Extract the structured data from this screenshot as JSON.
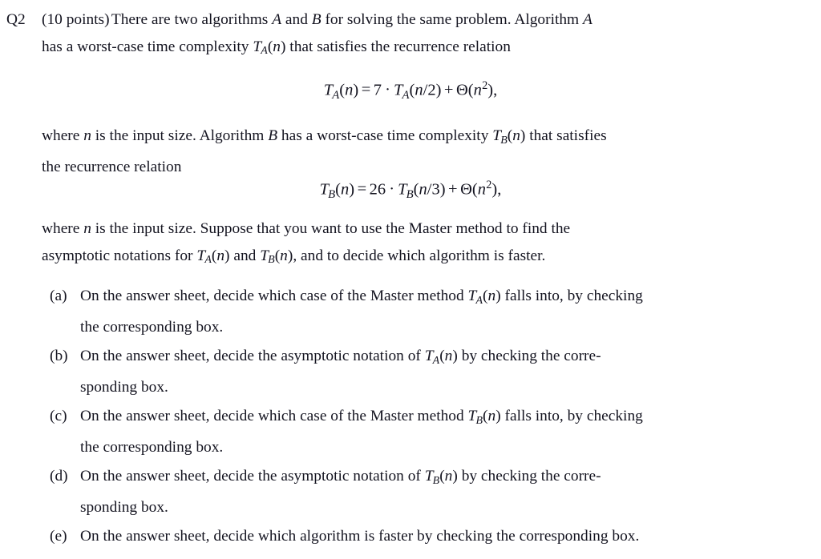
{
  "document": {
    "type": "exam-question",
    "background_color": "#ffffff",
    "text_color": "#141420"
  },
  "question": {
    "label": "Q2",
    "points_text": "(10 points)",
    "intro_line1_a": "There are two algorithms ",
    "intro_var_A": "A",
    "intro_line1_b": " and ",
    "intro_var_B": "B",
    "intro_line1_c": " for solving the same problem.  Algorithm ",
    "intro_var_A2": "A",
    "intro_line2_a": "has a worst-case time complexity ",
    "intro_math_TA": "T_A(n)",
    "intro_line2_b": " that satisfies the recurrence relation"
  },
  "equations": {
    "eq_A": {
      "plain": "T_A(n) = 7 · T_A(n/2) + Θ(n²),",
      "lhs_T": "T",
      "lhs_sub": "A",
      "lhs_arg": "(n)",
      "equals": "=",
      "coefficient": "7",
      "cdot": "·",
      "rec_T": "T",
      "rec_sub": "A",
      "rec_arg": "(n/2)",
      "plus": "+",
      "theta": "Θ",
      "theta_open": "(",
      "theta_var": "n",
      "theta_exp": "2",
      "theta_close": ")",
      "comma": ","
    },
    "eq_B": {
      "plain": "T_B(n) = 26 · T_B(n/3) + Θ(n²),",
      "lhs_T": "T",
      "lhs_sub": "B",
      "lhs_arg": "(n)",
      "equals": "=",
      "coefficient": "26",
      "cdot": "·",
      "rec_T": "T",
      "rec_sub": "B",
      "rec_arg": "(n/3)",
      "plus": "+",
      "theta": "Θ",
      "theta_open": "(",
      "theta_var": "n",
      "theta_exp": "2",
      "theta_close": ")",
      "comma": ","
    }
  },
  "paragraph_mid": {
    "part1": "where ",
    "var_n": "n",
    "part2": " is the input size.  Algorithm ",
    "var_B": "B",
    "part3": " has a worst-case time complexity ",
    "math_TB": "T_B(n)",
    "part4": " that satisfies",
    "line2": "the recurrence relation"
  },
  "paragraph_last": {
    "part1": "where ",
    "var_n": "n",
    "part2": " is the input size.  Suppose that you want to use the Master method to find the",
    "line2_part1": "asymptotic notations for ",
    "math_TA": "T_A(n)",
    "line2_part2": " and ",
    "math_TB": "T_B(n)",
    "line2_part3": ", and to decide which algorithm is faster."
  },
  "items": [
    {
      "marker": "(a)",
      "line1_part1": "On the answer sheet, decide which case of the Master method ",
      "math": "T_A(n)",
      "line1_part2": " falls into, by checking",
      "line2": "the corresponding box."
    },
    {
      "marker": "(b)",
      "line1_part1": "On the answer sheet, decide the asymptotic notation of ",
      "math": "T_A(n)",
      "line1_part2": " by checking the corre-",
      "line2": "sponding box."
    },
    {
      "marker": "(c)",
      "line1_part1": "On the answer sheet, decide which case of the Master method ",
      "math": "T_B(n)",
      "line1_part2": " falls into, by checking",
      "line2": "the corresponding box."
    },
    {
      "marker": "(d)",
      "line1_part1": "On the answer sheet, decide the asymptotic notation of ",
      "math": "T_B(n)",
      "line1_part2": " by checking the corre-",
      "line2": "sponding box."
    },
    {
      "marker": "(e)",
      "line1_part1": "On the answer sheet, decide which algorithm is faster by checking the corresponding box.",
      "math": "",
      "line1_part2": "",
      "line2": ""
    }
  ]
}
